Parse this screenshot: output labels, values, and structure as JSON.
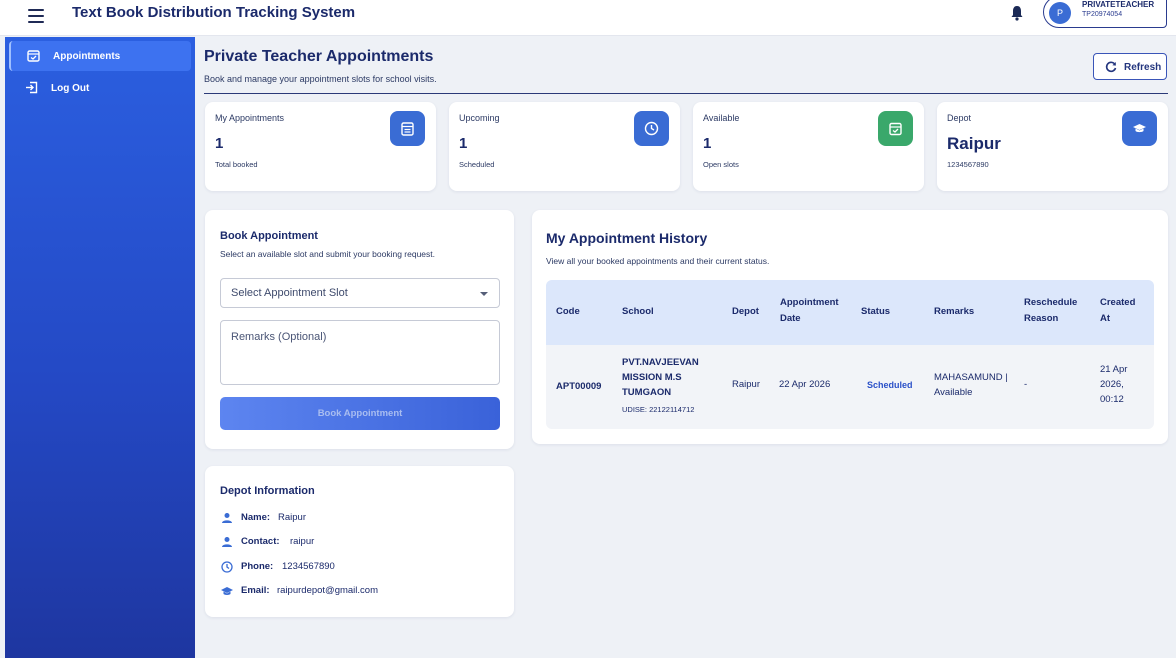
{
  "app": {
    "title": "Text Book Distribution Tracking System"
  },
  "user": {
    "initial": "P",
    "name": "PRIVATETEACHER",
    "id": "TP20974054"
  },
  "sidebar": {
    "items": [
      {
        "label": "Appointments",
        "icon": "calendar-check-icon",
        "active": true
      },
      {
        "label": "Log Out",
        "icon": "logout-icon",
        "active": false
      }
    ]
  },
  "header": {
    "title": "Private Teacher Appointments",
    "subtitle": "Book and manage your appointment slots for school visits.",
    "refresh_label": "Refresh"
  },
  "stats": [
    {
      "label": "My Appointments",
      "value": "1",
      "sub": "Total booked",
      "icon": "calendar-list-icon",
      "color": "#3a6cd4"
    },
    {
      "label": "Upcoming",
      "value": "1",
      "sub": "Scheduled",
      "icon": "clock-icon",
      "color": "#3a6cd4"
    },
    {
      "label": "Available",
      "value": "1",
      "sub": "Open slots",
      "icon": "calendar-check-icon",
      "color": "#3aa86b"
    },
    {
      "label": "Depot",
      "value": "Raipur",
      "sub": "1234567890",
      "icon": "graduation-cap-icon",
      "color": "#3a6cd4"
    }
  ],
  "book": {
    "title": "Book Appointment",
    "subtitle": "Select an available slot and submit your booking request.",
    "slot_placeholder": "Select Appointment Slot",
    "remarks_placeholder": "Remarks (Optional)",
    "button_label": "Book Appointment"
  },
  "history": {
    "title": "My Appointment History",
    "subtitle": "View all your booked appointments and their current status.",
    "columns": [
      "Code",
      "School",
      "Depot",
      "Appointment Date",
      "Status",
      "Remarks",
      "Reschedule Reason",
      "Created At"
    ],
    "rows": [
      {
        "code": "APT00009",
        "school_name": "PVT.NAVJEEVAN MISSION M.S TUMGAON",
        "udise": "UDISE: 22122114712",
        "depot": "Raipur",
        "date": "22 Apr 2026",
        "status": "Scheduled",
        "remarks": "MAHASAMUND | Available",
        "reschedule_reason": "-",
        "created_at": "21 Apr 2026, 00:12"
      }
    ]
  },
  "depot_info": {
    "title": "Depot Information",
    "rows": [
      {
        "key": "Name:",
        "value": "Raipur",
        "icon": "person-icon"
      },
      {
        "key": "Contact:",
        "value": "raipur",
        "icon": "person-icon"
      },
      {
        "key": "Phone:",
        "value": "1234567890",
        "icon": "clock-icon"
      },
      {
        "key": "Email:",
        "value": "raipurdepot@gmail.com",
        "icon": "graduation-cap-icon"
      }
    ]
  }
}
